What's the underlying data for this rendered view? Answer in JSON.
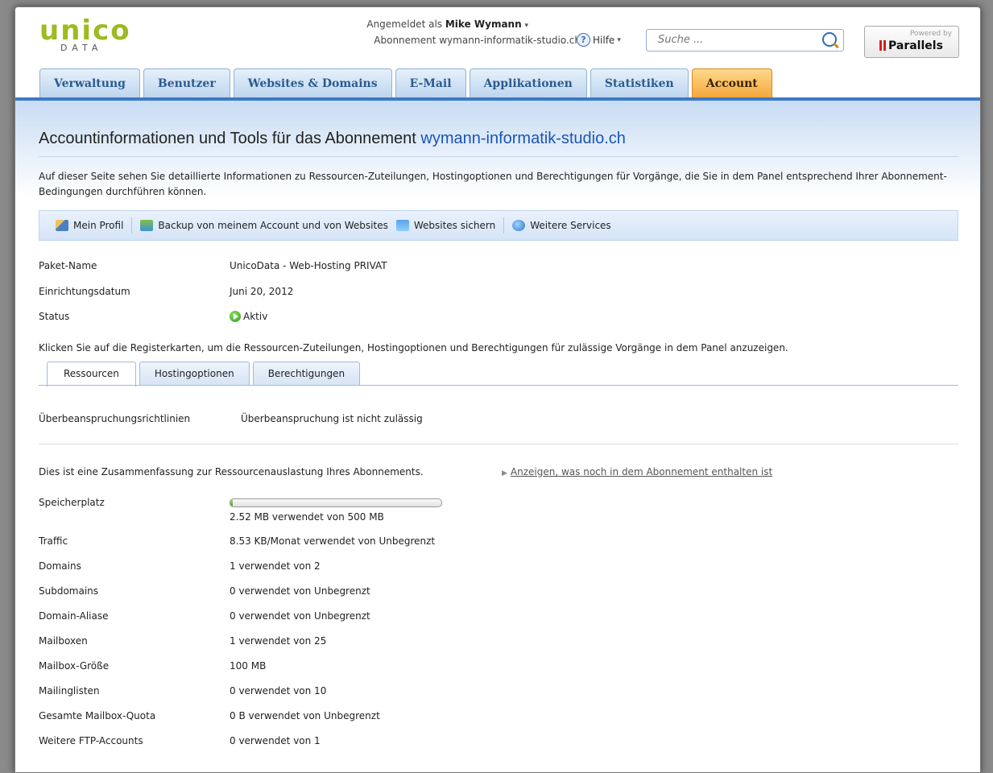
{
  "brand": {
    "word": "unico",
    "sub": "DATA"
  },
  "user": {
    "prefix": "Angemeldet als",
    "name": "Mike Wymann",
    "subscription": "Abonnement wymann-informatik-studio.ch"
  },
  "help": {
    "label": "Hilfe"
  },
  "search": {
    "placeholder": "Suche ..."
  },
  "powered": {
    "small": "Powered by",
    "name": "Parallels"
  },
  "nav": {
    "tabs": [
      {
        "label": "Verwaltung"
      },
      {
        "label": "Benutzer"
      },
      {
        "label": "Websites & Domains"
      },
      {
        "label": "E-Mail"
      },
      {
        "label": "Applikationen"
      },
      {
        "label": "Statistiken"
      },
      {
        "label": "Account"
      }
    ]
  },
  "page": {
    "title": "Accountinformationen und Tools für das Abonnement",
    "title_domain": "wymann-informatik-studio.ch",
    "description": "Auf dieser Seite sehen Sie detaillierte Informationen zu Ressourcen-Zuteilungen, Hostingoptionen und Berechtigungen für Vorgänge, die Sie in dem Panel entsprechend Ihrer Abonnement-Bedingungen durchführen können."
  },
  "toolbar": {
    "profile": "Mein Profil",
    "backup": "Backup von meinem Account und von Websites",
    "secure": "Websites sichern",
    "services": "Weitere Services"
  },
  "info": [
    {
      "key": "Paket-Name",
      "value": "UnicoData - Web-Hosting PRIVAT"
    },
    {
      "key": "Einrichtungsdatum",
      "value": "Juni 20, 2012"
    },
    {
      "key": "Status",
      "value": "Aktiv"
    }
  ],
  "note": "Klicken Sie auf die Registerkarten, um die Ressourcen-Zuteilungen, Hostingoptionen und Berechtigungen für zulässige Vorgänge in dem Panel anzuzeigen.",
  "subtabs": [
    {
      "label": "Ressourcen"
    },
    {
      "label": "Hostingoptionen"
    },
    {
      "label": "Berechtigungen"
    }
  ],
  "overuse": {
    "key": "Überbeanspruchungsrichtlinien",
    "value": "Überbeanspruchung ist nicht zulässig"
  },
  "summary": "Dies ist eine Zusammenfassung zur Ressourcenauslastung Ihres Abonnements.",
  "more_link": "Anzeigen, was noch in dem Abonnement enthalten ist",
  "storage": {
    "key": "Speicherplatz",
    "value": "2.52 MB verwendet von 500 MB",
    "used_fraction": 0.005
  },
  "resources": [
    {
      "key": "Traffic",
      "value": "8.53 KB/Monat verwendet von Unbegrenzt"
    },
    {
      "key": "Domains",
      "value": "1 verwendet von 2"
    },
    {
      "key": "Subdomains",
      "value": "0 verwendet von Unbegrenzt"
    },
    {
      "key": "Domain-Aliase",
      "value": "0 verwendet von Unbegrenzt"
    },
    {
      "key": "Mailboxen",
      "value": "1 verwendet von 25"
    },
    {
      "key": "Mailbox-Größe",
      "value": "100 MB"
    },
    {
      "key": "Mailinglisten",
      "value": "0 verwendet von 10"
    },
    {
      "key": "Gesamte Mailbox-Quota",
      "value": "0 B verwendet von Unbegrenzt"
    },
    {
      "key": "Weitere FTP-Accounts",
      "value": "0 verwendet von 1"
    }
  ]
}
